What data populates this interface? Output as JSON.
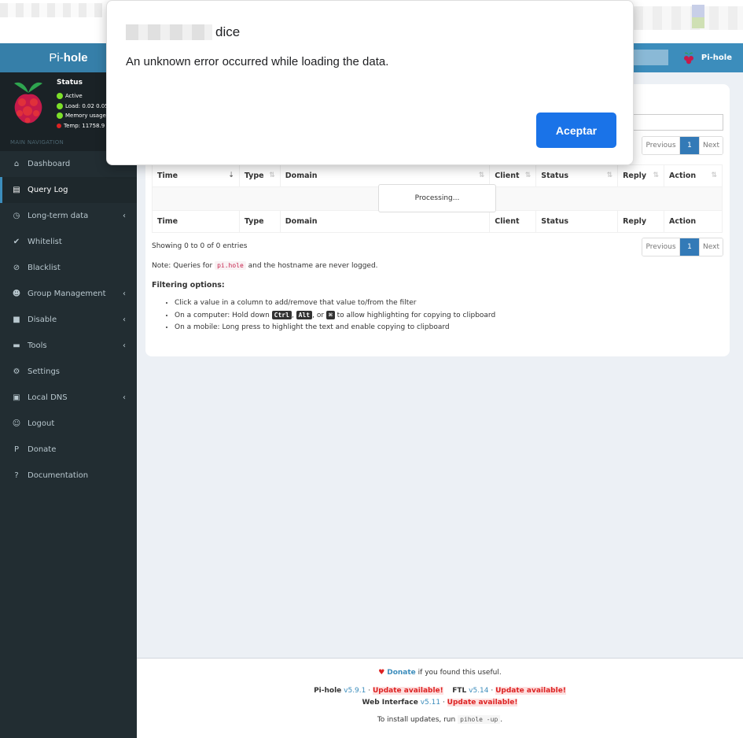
{
  "dialog": {
    "title_suffix": "dice",
    "message": "An unknown error occurred while loading the data.",
    "ok_label": "Aceptar"
  },
  "header": {
    "logo_light": "Pi-",
    "logo_bold": "hole",
    "user_label": "Pi-hole"
  },
  "status": {
    "title": "Status",
    "active": "Active",
    "load": "Load:  0.02  0.05",
    "memory": "Memory usage:",
    "temp": "Temp: 11758.9 °"
  },
  "nav": {
    "header": "MAIN NAVIGATION",
    "items": [
      {
        "label": "Dashboard",
        "icon": "home-icon"
      },
      {
        "label": "Query Log",
        "icon": "file-icon"
      },
      {
        "label": "Long-term data",
        "icon": "clock-icon"
      },
      {
        "label": "Whitelist",
        "icon": "check-circle-icon"
      },
      {
        "label": "Blacklist",
        "icon": "ban-icon"
      },
      {
        "label": "Group Management",
        "icon": "users-icon"
      },
      {
        "label": "Disable",
        "icon": "stop-icon"
      },
      {
        "label": "Tools",
        "icon": "folder-icon"
      },
      {
        "label": "Settings",
        "icon": "gears-icon"
      },
      {
        "label": "Local DNS",
        "icon": "address-book-icon"
      },
      {
        "label": "Logout",
        "icon": "user-times-icon"
      },
      {
        "label": "Donate",
        "icon": "paypal-icon"
      },
      {
        "label": "Documentation",
        "icon": "question-circle-icon"
      }
    ]
  },
  "pager": {
    "previous": "Previous",
    "page": "1",
    "next": "Next"
  },
  "table": {
    "columns": [
      "Time",
      "Type",
      "Domain",
      "Client",
      "Status",
      "Reply",
      "Action"
    ],
    "processing": "Processing..."
  },
  "info": {
    "showing": "Showing 0 to 0 of 0 entries",
    "note_pre": "Note: Queries for",
    "note_code": "pi.hole",
    "note_post": "and the hostname are never logged.",
    "filter_title": "Filtering options:",
    "filter_1": "Click a value in a column to add/remove that value to/from the filter",
    "filter_2_pre": "On a computer: Hold down",
    "kbd_ctrl": "Ctrl",
    "kbd_alt": "Alt",
    "kbd_cmd": "⌘",
    "filter_2_or": ", or",
    "filter_2_post": "to allow highlighting for copying to clipboard",
    "filter_3": "On a mobile: Long press to highlight the text and enable copying to clipboard"
  },
  "footer": {
    "donate": "Donate",
    "donate_post": "if you found this useful.",
    "pihole": "Pi-hole",
    "pihole_ver": "v5.9.1",
    "ftl": "FTL",
    "ftl_ver": "v5.14",
    "web": "Web Interface",
    "web_ver": "v5.11",
    "update": "Update available!",
    "install_pre": "To install updates, run",
    "install_cmd": "pihole -up",
    "install_post": "."
  },
  "colors": {
    "header": "#3c8dbc",
    "sidebar": "#222d32",
    "accent": "#1a73e8",
    "update": "#dd2222"
  }
}
